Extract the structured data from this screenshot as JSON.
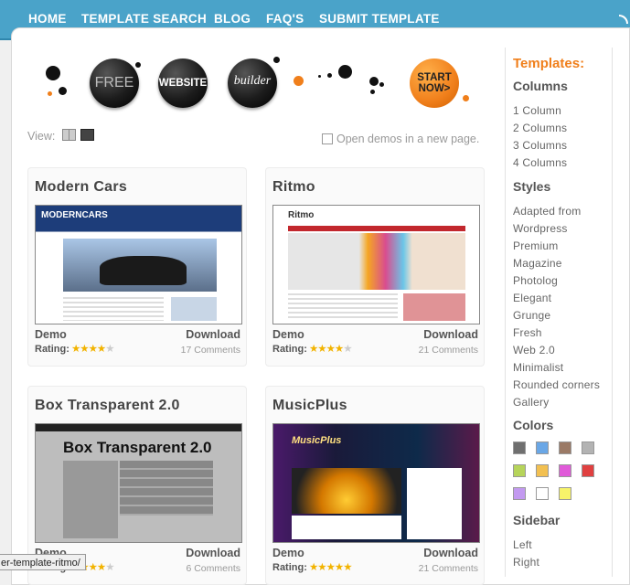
{
  "nav": {
    "home": "HOME",
    "search": "TEMPLATE SEARCH",
    "blog": "BLOG",
    "faq": "FAQ'S",
    "submit": "SUBMIT TEMPLATE"
  },
  "banner": {
    "free": "FREE",
    "website": "WEBSITE",
    "builder": "builder",
    "start": "START",
    "now": "NOW>"
  },
  "view": {
    "label": "View:",
    "open_new": "Open demos in a new page."
  },
  "cards": [
    {
      "title": "Modern Cars",
      "demo": "Demo",
      "download": "Download",
      "rating_label": "Rating:",
      "stars": 4,
      "comments": "17 Comments",
      "thumb_text": "MODERNCARS"
    },
    {
      "title": "Ritmo",
      "demo": "Demo",
      "download": "Download",
      "rating_label": "Rating:",
      "stars": 4,
      "comments": "21 Comments",
      "thumb_text": "Ritmo"
    },
    {
      "title": "Box Transparent 2.0",
      "demo": "Demo",
      "download": "Download",
      "rating_label": "Rating:",
      "stars": 4,
      "comments": "6 Comments",
      "thumb_text": "Box Transparent 2.0"
    },
    {
      "title": "MusicPlus",
      "demo": "Demo",
      "download": "Download",
      "rating_label": "Rating:",
      "stars": 5,
      "comments": "21 Comments",
      "thumb_text": "MusicPlus"
    }
  ],
  "sidebar": {
    "title": "Templates:",
    "columns_h": "Columns",
    "columns": [
      "1 Column",
      "2 Columns",
      "3 Columns",
      "4 Columns"
    ],
    "styles_h": "Styles",
    "styles": [
      "Adapted from",
      "Wordpress",
      "Premium",
      "Magazine",
      "Photolog",
      "Elegant",
      "Grunge",
      "Fresh",
      "Web 2.0",
      "Minimalist",
      "Rounded corners",
      "Gallery"
    ],
    "colors_h": "Colors",
    "colors": [
      "#6f6f6f",
      "#6aa7e6",
      "#9b7a66",
      "#b3b3b3",
      "#b6d45a",
      "#f2c051",
      "#e05ad9",
      "#e04040",
      "#c39af0",
      "#ffffff",
      "#f7f46a"
    ],
    "sidebar_h": "Sidebar",
    "sidebar_items": [
      "Left",
      "Right"
    ]
  },
  "status": {
    "url": "er-template-ritmo/"
  }
}
